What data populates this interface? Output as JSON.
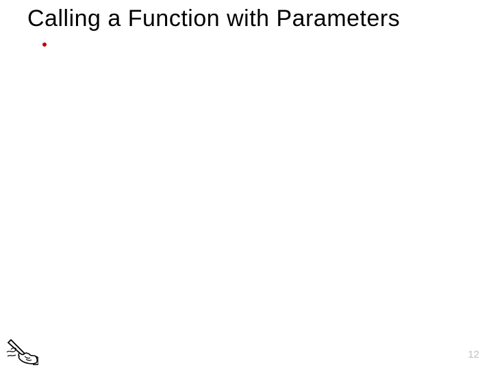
{
  "slide": {
    "title": "Calling a Function with Parameters",
    "page_number": "12"
  }
}
